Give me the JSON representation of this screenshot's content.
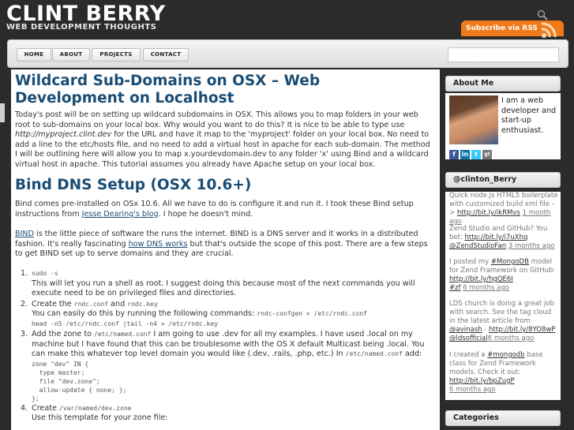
{
  "site": {
    "title": "CLINT BERRY",
    "tagline": "WEB DEVELOPMENT THOUGHTS",
    "rss_label": "Subscribe via RSS"
  },
  "nav": {
    "items": [
      "HOME",
      "ABOUT",
      "PROJECTS",
      "CONTACT"
    ],
    "search_placeholder": ""
  },
  "post": {
    "title": "Wildcard Sub-Domains on OSX – Web Development on Localhost",
    "intro_1": "Today's post will be on setting up wildcard subdomains in OSX. This allows you to map folders in your web root to sub-domains on your local box. Why would you want to do this? It is nice to be able to type use ",
    "intro_em": "http://myproject.clint.dev",
    "intro_2": " for the URL and have it map to the 'myproject' folder on your local box. No need to add a line to the etc/hosts file, and no need to add a virtual host in apache for each sub-domain. The method I will be outlining here will allow you to map x.yourdevdomain.dev to any folder 'x' using Bind and a wildcard virtual host in apache. This tutorial assumes you already have Apache setup on your local box.",
    "h2": "Bind DNS Setup (OSX 10.6+)",
    "p2_1": "Bind comes pre-installed on OSx 10.6. All we have to do is configure it and run it. I took these Bind setup instructions from ",
    "p2_link": "Jesse Dearing's blog",
    "p2_2": ". I hope he doesn't mind.",
    "p3_link1": "BIND",
    "p3_1": " is the little piece of software the runs the internet. BIND is a DNS server and it works in a distributed fashion. It's really fascinating ",
    "p3_link2": "how DNS works",
    "p3_2": " but that's outside the scope of this post. There are a few steps to get BIND set up to serve domains and they are crucial.",
    "steps": {
      "s1_num": "1.",
      "s1_code": "sudo -s",
      "s1_text": "This will let you run a shell as root. I suggest doing this because most of the next commands you will execute need to be on privileged files and directories.",
      "s2_num": "2.",
      "s2_a": "Create the ",
      "s2_code1": "rndc.conf",
      "s2_b": " and ",
      "s2_code2": "rndc.key",
      "s2_c": "You can easily do this by running the following commands: ",
      "s2_code3": "rndc-confgen > /etc/rndc.conf",
      "s2_code4": "head -n5 /etc/rndc.conf |tail -n4 > /etc/rndc.key",
      "s3_num": "3.",
      "s3_a": "Add the zone to ",
      "s3_code1": "/etc/named.conf",
      "s3_b": " I am going to use .dev for all my examples. I have used .local on my machine but I have found that this can be troublesome with the OS X default Multicast being .local. You can make this whatever top level domain you would like (.dev, .rails, .php, etc.) In ",
      "s3_code2": "/etc/named.conf",
      "s3_c": " add:",
      "s3_block": "zone \"dev\" IN {\n  type master;\n  file \"dev.zone\";\n  allow-update { none; };\n};",
      "s4_num": "4.",
      "s4_a": "Create ",
      "s4_code": "/var/named/dev.zone",
      "s4_b": "Use this template for your zone file:"
    }
  },
  "sidebar": {
    "about_head": "About Me",
    "about_text": "I am a web developer and start-up enthusiast.",
    "social": [
      "f",
      "in",
      "t",
      "gt"
    ],
    "twitter_head": "@clinton_Berry",
    "tweets": [
      {
        "text": "Quick node.js HTML5 boilerplate with customized build xml file -> ",
        "link": "http://bit.ly/ikRMvs",
        "ago": "1 month ago"
      },
      {
        "text": "Zend Studio and GitHub? You bet: ",
        "link": "http://bit.ly/i7uXhq",
        "extra": " @ZendStudioFan",
        "ago": "3 months ago"
      },
      {
        "text": "I posted my ",
        "tag": "#MongoDB",
        "text2": " model for Zend Framework on GitHub: ",
        "link": "http://bit.ly/hgQE6I",
        "tag2": " #zf",
        "ago": "6 months ago"
      },
      {
        "text": "LDS church is doing a great job with search. See the tag cloud in the latest article from ",
        "handle": "@avinash",
        "text2": " - ",
        "link": "http://bit.ly/8YO8wP",
        "handle2": " @ldsofficial",
        "ago": "6 months ago"
      },
      {
        "text": "I created a ",
        "tag": "#mongodb",
        "text2": " base class for Zend Framework models. Check it out: ",
        "link": "http://bit.ly/bpZugP",
        "ago": "6 months ago"
      }
    ],
    "categories_head": "Categories"
  },
  "colors": {
    "background": "#2b2b2b",
    "accent": "#1b4d74",
    "rss_orange": "#f07a1a"
  }
}
